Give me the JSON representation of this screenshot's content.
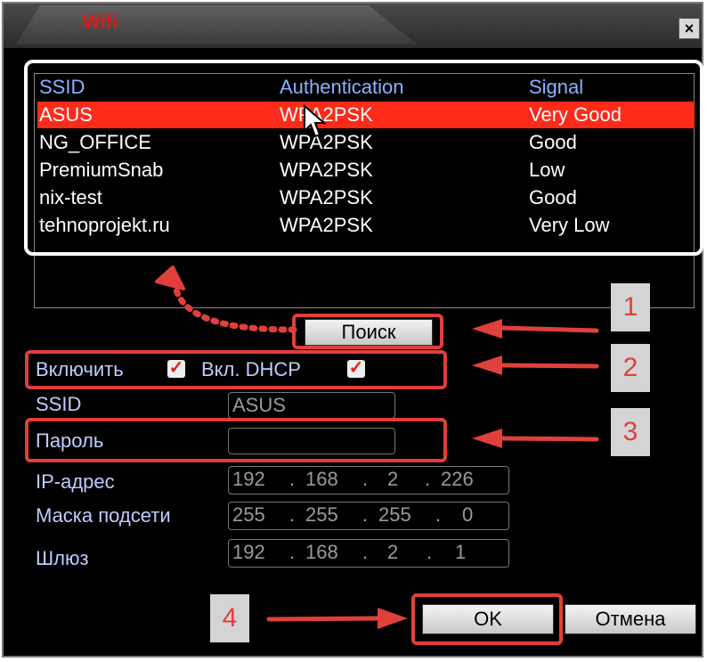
{
  "window": {
    "title": "Wifi",
    "close": "×"
  },
  "list": {
    "headers": [
      "SSID",
      "Authentication",
      "Signal"
    ],
    "rows": [
      {
        "ssid": "ASUS",
        "auth": "WPA2PSK",
        "signal": "Very Good"
      },
      {
        "ssid": "NG_OFFICE",
        "auth": "WPA2PSK",
        "signal": "Good"
      },
      {
        "ssid": "PremiumSnab",
        "auth": "WPA2PSK",
        "signal": "Low"
      },
      {
        "ssid": "nix-test",
        "auth": "WPA2PSK",
        "signal": "Good"
      },
      {
        "ssid": "tehnoprojekt.ru",
        "auth": "WPA2PSK",
        "signal": "Very Low"
      }
    ],
    "selected_index": 0
  },
  "search_button": "Поиск",
  "enable": {
    "label": "Включить",
    "checked": true
  },
  "dhcp": {
    "label": "Вкл. DHCP",
    "checked": true
  },
  "fields": {
    "ssid": {
      "label": "SSID",
      "value": "ASUS"
    },
    "password": {
      "label": "Пароль",
      "value": ""
    },
    "ip": {
      "label": "IP-адрес",
      "segments": [
        "192",
        "168",
        "2",
        "226"
      ]
    },
    "mask": {
      "label": "Маска подсети",
      "segments": [
        "255",
        "255",
        "255",
        "0"
      ]
    },
    "gateway": {
      "label": "Шлюз",
      "segments": [
        "192",
        "168",
        "2",
        "1"
      ]
    }
  },
  "buttons": {
    "ok": "OK",
    "cancel": "Отмена"
  },
  "annotations": [
    "1",
    "2",
    "3",
    "4"
  ],
  "colors": {
    "accent_red": "#e0403a",
    "selected_row": "#ff2a1a",
    "label_blue": "#c0ccff",
    "header_blue": "#8ab2ff"
  }
}
